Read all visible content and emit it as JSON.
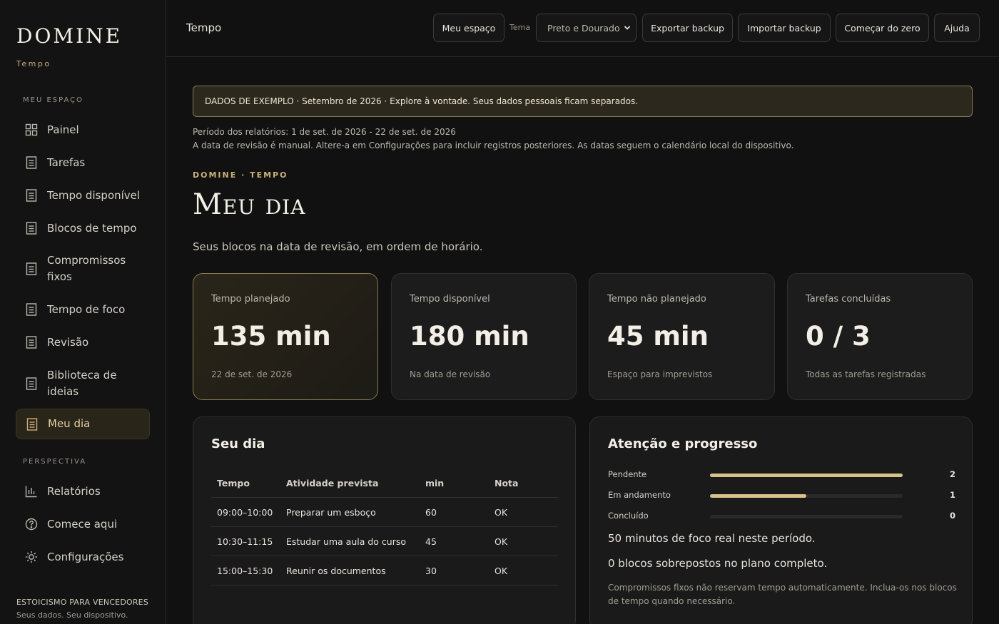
{
  "brand": {
    "title": "DOMINE",
    "subtitle": "Tempo"
  },
  "sidebar": {
    "section_main": "MEU ESPAÇO",
    "items": [
      {
        "label": "Painel",
        "icon": "grid-icon"
      },
      {
        "label": "Tarefas",
        "icon": "document-icon"
      },
      {
        "label": "Tempo disponível",
        "icon": "document-icon"
      },
      {
        "label": "Blocos de tempo",
        "icon": "document-icon"
      },
      {
        "label": "Compromissos fixos",
        "icon": "document-icon"
      },
      {
        "label": "Tempo de foco",
        "icon": "document-icon"
      },
      {
        "label": "Revisão",
        "icon": "document-icon"
      },
      {
        "label": "Biblioteca de ideias",
        "icon": "document-icon"
      },
      {
        "label": "Meu dia",
        "icon": "document-icon",
        "active": true
      }
    ],
    "section_perspective": "PERSPECTIVA",
    "items2": [
      {
        "label": "Relatórios",
        "icon": "bar-chart-icon"
      },
      {
        "label": "Comece aqui",
        "icon": "help-circle-icon"
      },
      {
        "label": "Configurações",
        "icon": "sun-gear-icon"
      }
    ],
    "footer_title": "ESTOICISMO PARA VENCEDORES",
    "footer_sub": "Seus dados. Seu dispositivo."
  },
  "topbar": {
    "title": "Tempo",
    "my_space": "Meu espaço",
    "theme_label": "Tema",
    "theme_value": "Preto e Dourado",
    "export": "Exportar backup",
    "import": "Importar backup",
    "reset": "Começar do zero",
    "help": "Ajuda"
  },
  "banner": "DADOS DE EXEMPLO · Setembro de 2026 · Explore à vontade. Seus dados pessoais ficam separados.",
  "meta": {
    "period": "Período dos relatórios: 1 de set. de 2026 - 22 de set. de 2026",
    "note": "A data de revisão é manual. Altere-a em Configurações para incluir registros posteriores. As datas seguem o calendário local do dispositivo."
  },
  "page": {
    "eyebrow": "DOMINE · TEMPO",
    "title": "Meu dia",
    "subtitle": "Seus blocos na data de revisão, em ordem de horário."
  },
  "cards": [
    {
      "label": "Tempo planejado",
      "value": "135 min",
      "sub": "22 de set. de 2026"
    },
    {
      "label": "Tempo disponível",
      "value": "180 min",
      "sub": "Na data de revisão"
    },
    {
      "label": "Tempo não planejado",
      "value": "45 min",
      "sub": "Espaço para imprevistos"
    },
    {
      "label": "Tarefas concluídas",
      "value": "0 / 3",
      "sub": "Todas as tarefas registradas"
    }
  ],
  "day": {
    "title": "Seu dia",
    "columns": [
      "Tempo",
      "Atividade prevista",
      "min",
      "Nota"
    ],
    "rows": [
      [
        "09:00–10:00",
        "Preparar um esboço",
        "60",
        "OK"
      ],
      [
        "10:30–11:15",
        "Estudar uma aula do curso",
        "45",
        "OK"
      ],
      [
        "15:00–15:30",
        "Reunir os documentos",
        "30",
        "OK"
      ]
    ]
  },
  "progress": {
    "title": "Atenção e progresso",
    "rows": [
      {
        "label": "Pendente",
        "value": "2",
        "fraction": 1.0
      },
      {
        "label": "Em andamento",
        "value": "1",
        "fraction": 0.5
      },
      {
        "label": "Concluído",
        "value": "0",
        "fraction": 0.0
      }
    ],
    "focus_text": "50 minutos de foco real neste período.",
    "overlap_text": "0 blocos sobrepostos no plano completo.",
    "note": "Compromissos fixos não reservam tempo automaticamente. Inclua-os nos blocos de tempo quando necessário."
  },
  "colors": {
    "accent": "#c9b27a",
    "bar": "#d6c38c",
    "background": "#111111"
  }
}
